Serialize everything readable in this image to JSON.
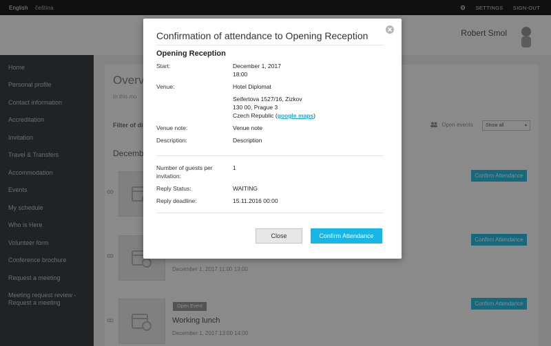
{
  "topbar": {
    "languages": [
      "English",
      "čeština"
    ],
    "settings_label": "SETTINGS",
    "signout_label": "SIGN-OUT"
  },
  "header": {
    "username": "Robert Smol"
  },
  "sidebar": {
    "items": [
      {
        "label": "Home"
      },
      {
        "label": "Personal profile"
      },
      {
        "label": "Contact information"
      },
      {
        "label": "Accreditation"
      },
      {
        "label": "Invitation"
      },
      {
        "label": "Travel & Transfers"
      },
      {
        "label": "Accommodation"
      },
      {
        "label": "Events"
      },
      {
        "label": "My schedule"
      },
      {
        "label": "Who is Here"
      },
      {
        "label": "Volunteer form"
      },
      {
        "label": "Conference brochure"
      },
      {
        "label": "Request a meeting"
      },
      {
        "label": "Meeting request review - Request a meeting"
      }
    ]
  },
  "main": {
    "title": "Overv",
    "subtitle": "In this mo",
    "filter_label": "Filter of di",
    "open_events_label": "Open events",
    "filter_select_value": "Show all",
    "date_header": "Decembe",
    "events": [
      {
        "badge": "",
        "title": "",
        "time": "",
        "button": "Confirm Attendance"
      },
      {
        "badge": "",
        "title": "",
        "time": "December 1, 2017 11:00 13:00",
        "button": "Confirm Attendance"
      },
      {
        "badge": "Open Event",
        "title": "Working lunch",
        "time": "December 1, 2017 13:00 14:00",
        "button": "Confirm Attendance"
      }
    ]
  },
  "modal": {
    "title": "Confirmation of attendance to Opening Reception",
    "event_name": "Opening Reception",
    "fields": {
      "start_label": "Start:",
      "start_date": "December 1, 2017",
      "start_time": "18:00",
      "venue_label": "Venue:",
      "venue_name": "Hotel Diplomat",
      "address_line1": "Seifertova 1527/16, Zizkov",
      "address_line2": "130 00, Prague 3",
      "address_country": "Czech Republic (",
      "maps_link": "google maps",
      "address_close": ")",
      "venue_note_label": "Venue note:",
      "venue_note_value": "Venue note",
      "description_label": "Description:",
      "description_value": "Description",
      "guests_label": "Number of guests per invitation:",
      "guests_value": "1",
      "reply_status_label": "Reply Status:",
      "reply_status_value": "WAITING",
      "reply_deadline_label": "Reply deadline:",
      "reply_deadline_value": "15.11.2016 00:00"
    },
    "close_button": "Close",
    "confirm_button": "Confirm Attendance"
  },
  "colors": {
    "accent": "#17b6e6",
    "sidebar": "#3b3f44",
    "topbar": "#1e1e1e"
  }
}
